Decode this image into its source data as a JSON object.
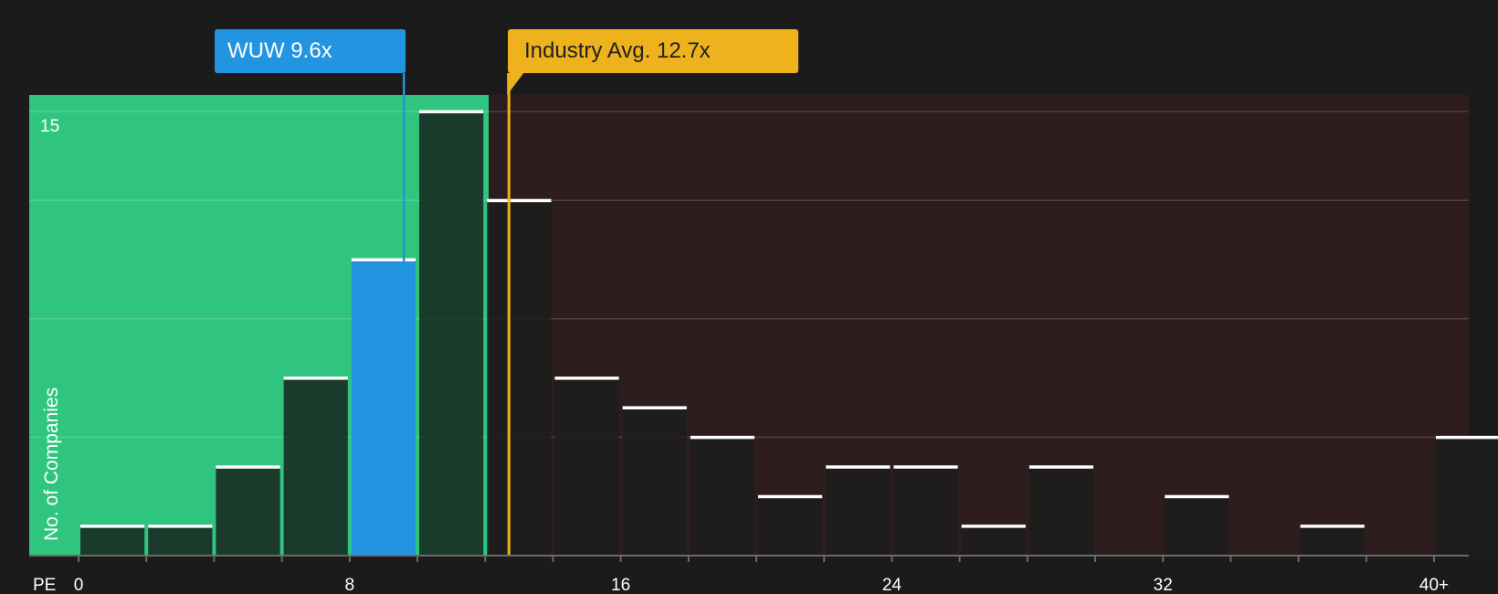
{
  "chart_data": {
    "type": "bar",
    "x_axis_title": "PE",
    "y_axis_title": "No. of Companies",
    "x_tick_labels": [
      "0",
      "8",
      "16",
      "24",
      "32",
      "40+"
    ],
    "x_tick_values": [
      0,
      8,
      16,
      24,
      32,
      40
    ],
    "y_tick_label": "15",
    "ylim": [
      0,
      15.5
    ],
    "bin_width": 2,
    "bins": [
      {
        "start": 0,
        "end": 2,
        "count": 1
      },
      {
        "start": 2,
        "end": 4,
        "count": 1
      },
      {
        "start": 4,
        "end": 6,
        "count": 3
      },
      {
        "start": 6,
        "end": 8,
        "count": 6
      },
      {
        "start": 8,
        "end": 10,
        "count": 10
      },
      {
        "start": 10,
        "end": 12,
        "count": 15
      },
      {
        "start": 12,
        "end": 14,
        "count": 12
      },
      {
        "start": 14,
        "end": 16,
        "count": 6
      },
      {
        "start": 16,
        "end": 18,
        "count": 5
      },
      {
        "start": 18,
        "end": 20,
        "count": 4
      },
      {
        "start": 20,
        "end": 22,
        "count": 2
      },
      {
        "start": 22,
        "end": 24,
        "count": 3
      },
      {
        "start": 24,
        "end": 26,
        "count": 3
      },
      {
        "start": 26,
        "end": 28,
        "count": 1
      },
      {
        "start": 28,
        "end": 30,
        "count": 3
      },
      {
        "start": 30,
        "end": 32,
        "count": 0
      },
      {
        "start": 32,
        "end": 34,
        "count": 2
      },
      {
        "start": 34,
        "end": 36,
        "count": 0
      },
      {
        "start": 36,
        "end": 38,
        "count": 1
      },
      {
        "start": 38,
        "end": 40,
        "count": 0
      },
      {
        "start": 40,
        "end": 42,
        "count": 4
      }
    ],
    "company": {
      "label": "WUW 9.6x",
      "value": 9.6
    },
    "industry_average": {
      "label": "Industry Avg. 12.7x",
      "value": 12.7
    },
    "colors": {
      "background": "#1b1b1b",
      "undervalued_zone": "#2fc57f",
      "overvalued_zone": "#2e1d1e",
      "company": "#2394e0",
      "industry": "#eeb21c",
      "bar_top": "#ffffff"
    }
  }
}
